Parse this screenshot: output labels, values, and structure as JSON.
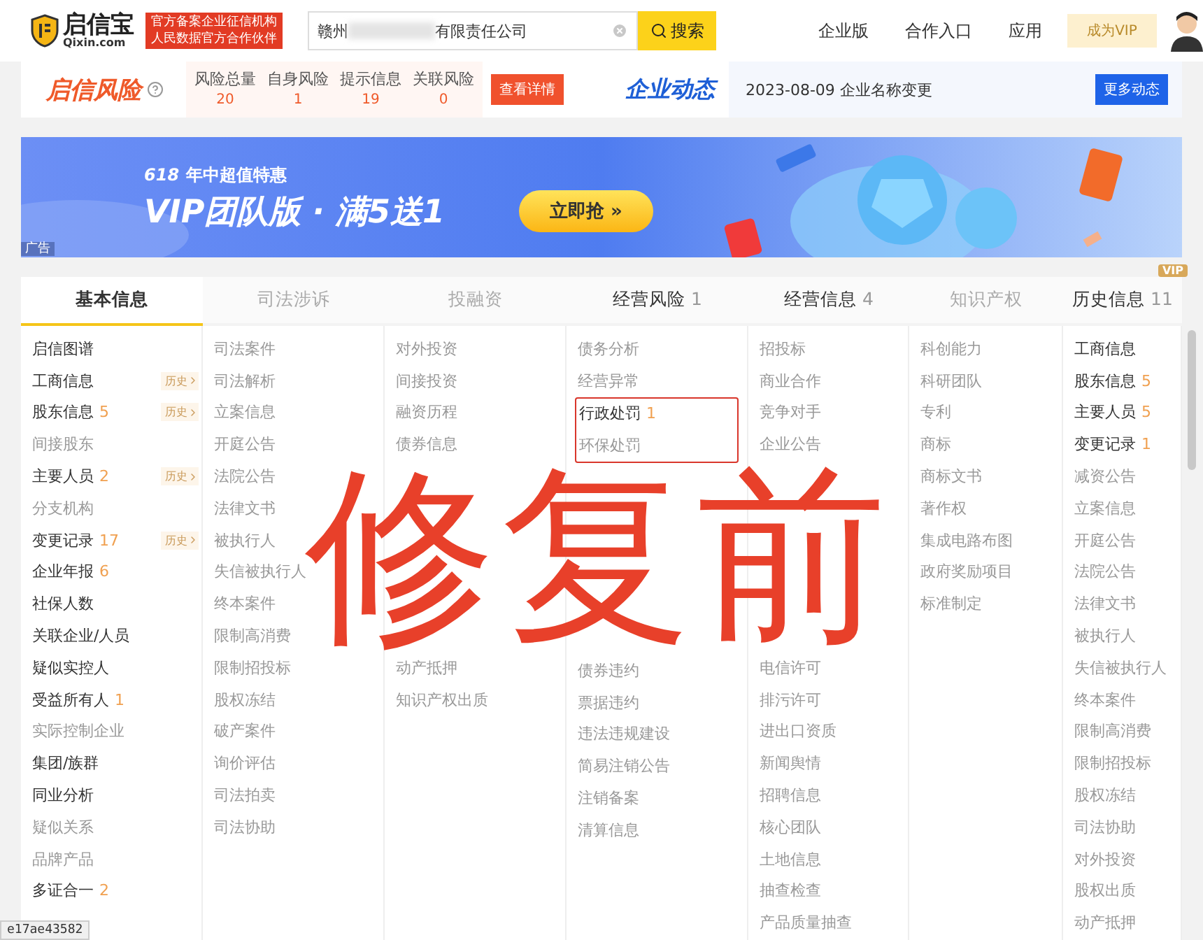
{
  "header": {
    "logo": {
      "name": "启信宝",
      "domain": "Qixin.com"
    },
    "tagline": [
      "官方备案企业征信机构",
      "人民数据官方合作伙伴"
    ],
    "search": {
      "value_start": "赣州",
      "value_end": "有限责任公司",
      "button": "搜索"
    },
    "nav": [
      "企业版",
      "合作入口",
      "应用"
    ],
    "vip_button": "成为VIP"
  },
  "risk": {
    "title": "启信风险",
    "stats": [
      {
        "label": "风险总量",
        "value": "20"
      },
      {
        "label": "自身风险",
        "value": "1"
      },
      {
        "label": "提示信息",
        "value": "19"
      },
      {
        "label": "关联风险",
        "value": "0"
      }
    ],
    "button": "查看详情"
  },
  "news": {
    "title": "企业动态",
    "date": "2023-08-09",
    "text": "企业名称变更",
    "button": "更多动态"
  },
  "banner": {
    "badge": "618",
    "subtitle": "年中超值特惠",
    "headline": "VIP团队版 · 满5送1",
    "cta": "立即抢 »",
    "ad_label": "广告"
  },
  "tabs": [
    {
      "label": "基本信息",
      "selected": true,
      "disabled": false
    },
    {
      "label": "司法涉诉",
      "selected": false,
      "disabled": true
    },
    {
      "label": "投融资",
      "selected": false,
      "disabled": true
    },
    {
      "label": "经营风险",
      "count": "1",
      "selected": false,
      "disabled": false
    },
    {
      "label": "经营信息",
      "count": "4",
      "selected": false,
      "disabled": false
    },
    {
      "label": "知识产权",
      "selected": false,
      "disabled": true
    },
    {
      "label": "历史信息",
      "count": "11",
      "badge": "VIP",
      "selected": false,
      "disabled": false
    }
  ],
  "columns": [
    {
      "items": [
        {
          "label": "启信图谱",
          "disabled": false
        },
        {
          "label": "工商信息",
          "disabled": false,
          "history": "历史"
        },
        {
          "label": "股东信息",
          "count": "5",
          "disabled": false,
          "history": "历史"
        },
        {
          "label": "间接股东",
          "disabled": true
        },
        {
          "label": "主要人员",
          "count": "2",
          "disabled": false,
          "history": "历史"
        },
        {
          "label": "分支机构",
          "disabled": true
        },
        {
          "label": "变更记录",
          "count": "17",
          "disabled": false,
          "history": "历史"
        },
        {
          "label": "企业年报",
          "count": "6",
          "disabled": false
        },
        {
          "label": "社保人数",
          "disabled": false
        },
        {
          "label": "关联企业/人员",
          "disabled": false
        },
        {
          "label": "疑似实控人",
          "disabled": false
        },
        {
          "label": "受益所有人",
          "count": "1",
          "disabled": false
        },
        {
          "label": "实际控制企业",
          "disabled": true
        },
        {
          "label": "集团/族群",
          "disabled": false
        },
        {
          "label": "同业分析",
          "disabled": false
        },
        {
          "label": "疑似关系",
          "disabled": true
        },
        {
          "label": "品牌产品",
          "disabled": true
        },
        {
          "label": "多证合一",
          "count": "2",
          "disabled": false
        }
      ]
    },
    {
      "items": [
        {
          "label": "司法案件",
          "disabled": true
        },
        {
          "label": "司法解析",
          "disabled": true
        },
        {
          "label": "立案信息",
          "disabled": true
        },
        {
          "label": "开庭公告",
          "disabled": true
        },
        {
          "label": "法院公告",
          "disabled": true
        },
        {
          "label": "法律文书",
          "disabled": true
        },
        {
          "label": "被执行人",
          "disabled": true
        },
        {
          "label": "失信被执行人",
          "disabled": true
        },
        {
          "label": "终本案件",
          "disabled": true
        },
        {
          "label": "限制高消费",
          "disabled": true
        },
        {
          "label": "限制招投标",
          "disabled": true
        },
        {
          "label": "股权冻结",
          "disabled": true
        },
        {
          "label": "破产案件",
          "disabled": true
        },
        {
          "label": "询价评估",
          "disabled": true
        },
        {
          "label": "司法拍卖",
          "disabled": true
        },
        {
          "label": "司法协助",
          "disabled": true
        }
      ]
    },
    {
      "items": [
        {
          "label": "对外投资",
          "disabled": true
        },
        {
          "label": "间接投资",
          "disabled": true
        },
        {
          "label": "融资历程",
          "disabled": true
        },
        {
          "label": "债券信息",
          "disabled": true
        }
      ],
      "items_below": [
        {
          "label": "动产抵押",
          "disabled": true
        },
        {
          "label": "知识产权出质",
          "disabled": true
        }
      ]
    },
    {
      "items": [
        {
          "label": "债务分析",
          "disabled": true
        },
        {
          "label": "经营异常",
          "disabled": true
        },
        {
          "label": "行政处罚",
          "count": "1",
          "disabled": false,
          "boxed": true
        },
        {
          "label": "环保处罚",
          "disabled": true,
          "boxed": true
        }
      ],
      "items_below": [
        {
          "label": "债券违约",
          "disabled": true
        },
        {
          "label": "票据违约",
          "disabled": true
        },
        {
          "label": "违法违规建设",
          "disabled": true
        },
        {
          "label": "简易注销公告",
          "disabled": true
        },
        {
          "label": "注销备案",
          "disabled": true
        },
        {
          "label": "清算信息",
          "disabled": true
        }
      ]
    },
    {
      "items": [
        {
          "label": "招投标",
          "disabled": true
        },
        {
          "label": "商业合作",
          "disabled": true
        },
        {
          "label": "竞争对手",
          "disabled": true
        },
        {
          "label": "企业公告",
          "disabled": true
        }
      ],
      "items_below": [
        {
          "label": "电信许可",
          "disabled": true
        },
        {
          "label": "排污许可",
          "disabled": true
        },
        {
          "label": "进出口资质",
          "disabled": true
        },
        {
          "label": "新闻舆情",
          "disabled": true
        },
        {
          "label": "招聘信息",
          "disabled": true
        },
        {
          "label": "核心团队",
          "disabled": true
        },
        {
          "label": "土地信息",
          "disabled": true
        },
        {
          "label": "抽查检查",
          "disabled": true
        },
        {
          "label": "产品质量抽查",
          "disabled": true
        }
      ]
    },
    {
      "items": [
        {
          "label": "科创能力",
          "disabled": true
        },
        {
          "label": "科研团队",
          "disabled": true
        },
        {
          "label": "专利",
          "disabled": true
        },
        {
          "label": "商标",
          "disabled": true
        },
        {
          "label": "商标文书",
          "disabled": true
        },
        {
          "label": "著作权",
          "disabled": true
        },
        {
          "label": "集成电路布图",
          "disabled": true
        },
        {
          "label": "政府奖励项目",
          "disabled": true
        },
        {
          "label": "标准制定",
          "disabled": true
        }
      ]
    },
    {
      "items": [
        {
          "label": "工商信息",
          "disabled": false
        },
        {
          "label": "股东信息",
          "count": "5",
          "disabled": false
        },
        {
          "label": "主要人员",
          "count": "5",
          "disabled": false
        },
        {
          "label": "变更记录",
          "count": "1",
          "disabled": false
        },
        {
          "label": "减资公告",
          "disabled": true
        },
        {
          "label": "立案信息",
          "disabled": true
        },
        {
          "label": "开庭公告",
          "disabled": true
        },
        {
          "label": "法院公告",
          "disabled": true
        },
        {
          "label": "法律文书",
          "disabled": true
        },
        {
          "label": "被执行人",
          "disabled": true
        },
        {
          "label": "失信被执行人",
          "disabled": true
        },
        {
          "label": "终本案件",
          "disabled": true
        },
        {
          "label": "限制高消费",
          "disabled": true
        },
        {
          "label": "限制招投标",
          "disabled": true
        },
        {
          "label": "股权冻结",
          "disabled": true
        },
        {
          "label": "司法协助",
          "disabled": true
        },
        {
          "label": "对外投资",
          "disabled": true
        },
        {
          "label": "股权出质",
          "disabled": true
        },
        {
          "label": "动产抵押",
          "disabled": true
        }
      ]
    }
  ],
  "annotation": "修复前",
  "status_url": "e17ae43582"
}
